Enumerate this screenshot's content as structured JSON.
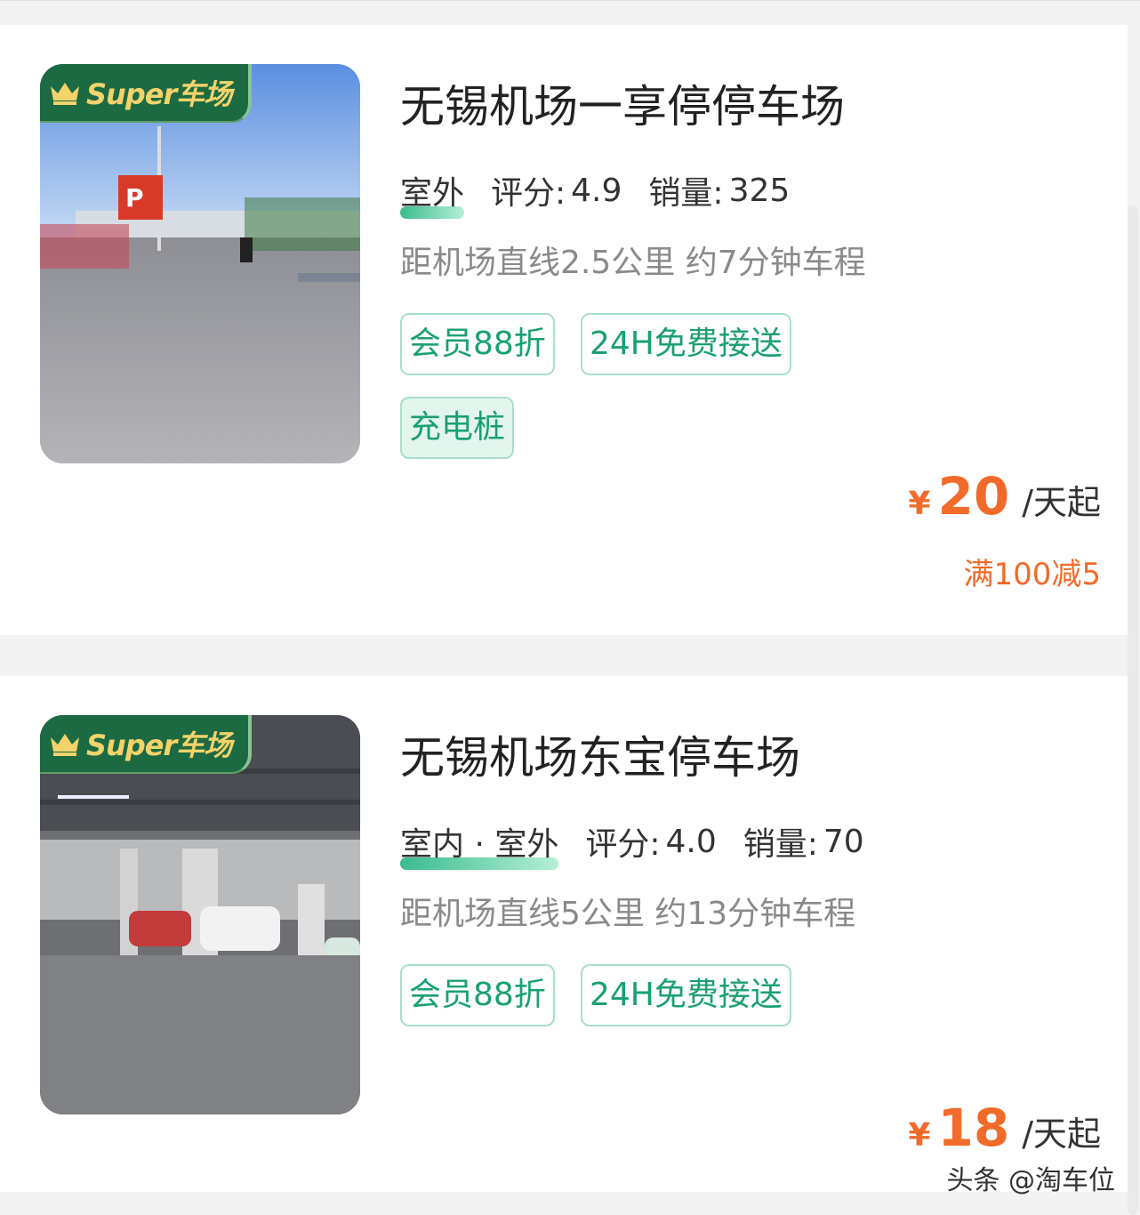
{
  "listings": [
    {
      "badge_text": "Super车场",
      "name": "无锡机场一享停停车场",
      "type": "室外",
      "rating_label": "评分:",
      "rating": "4.9",
      "sales_label": "销量:",
      "sales": "325",
      "distance": "距机场直线2.5公里 约7分钟车程",
      "tags": [
        "会员88折",
        "24H免费接送",
        "充电桩"
      ],
      "currency": "¥",
      "price": "20",
      "price_unit": "/天起",
      "promo": "满100减5"
    },
    {
      "badge_text": "Super车场",
      "name": "无锡机场东宝停车场",
      "type": "室内 · 室外",
      "rating_label": "评分:",
      "rating": "4.0",
      "sales_label": "销量:",
      "sales": "70",
      "distance": "距机场直线5公里 约13分钟车程",
      "tags": [
        "会员88折",
        "24H免费接送"
      ],
      "currency": "¥",
      "price": "18",
      "price_unit": "/天起"
    }
  ],
  "watermark": "头条 @淘车位",
  "colors": {
    "accent_green": "#1aa072",
    "price_orange": "#f26b2a",
    "badge_green": "#1c6a42",
    "badge_gold": "#f3d36a"
  }
}
